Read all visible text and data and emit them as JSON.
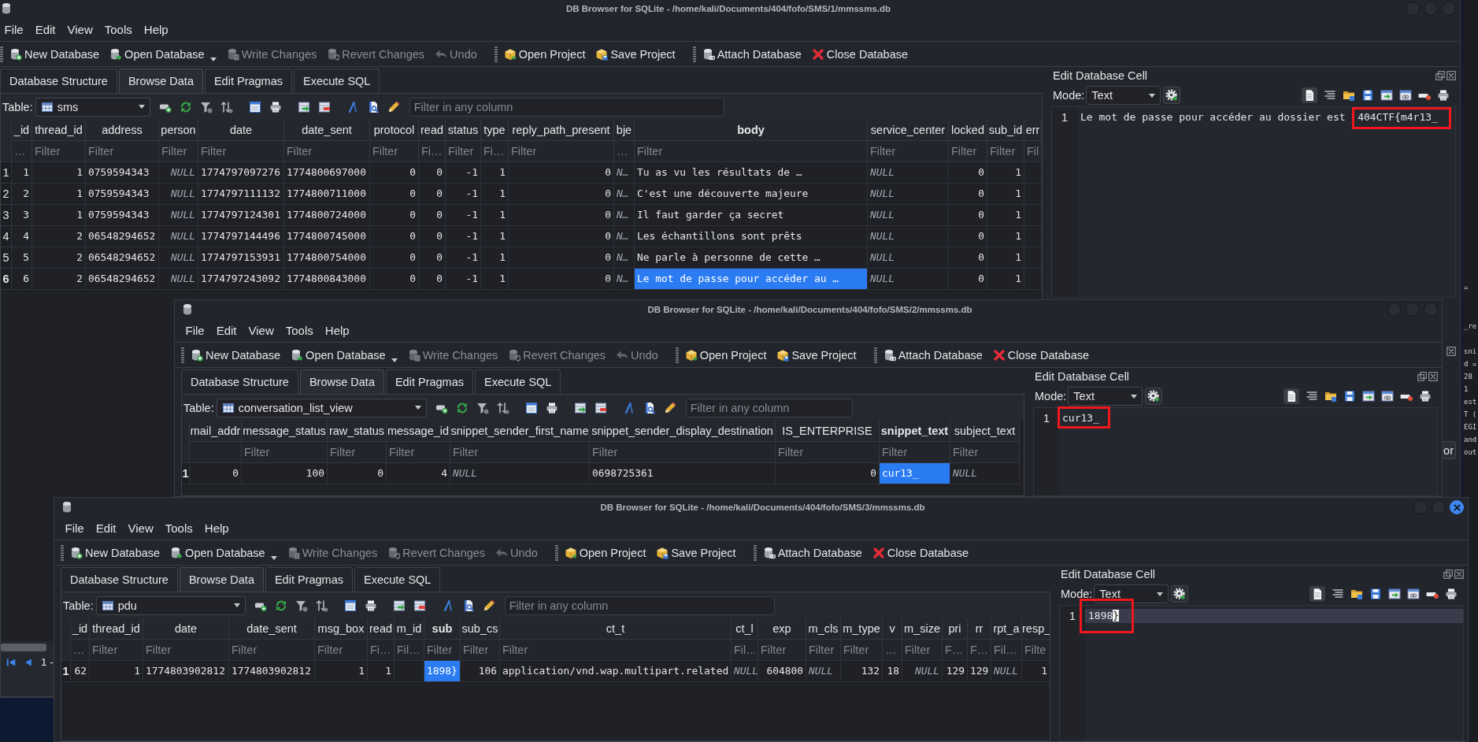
{
  "windows": [
    {
      "title": "DB Browser for SQLite - /home/kali/Documents/404/fofo/SMS/1/mmssms.db",
      "active": false,
      "menu": [
        "File",
        "Edit",
        "View",
        "Tools",
        "Help"
      ],
      "toolbar": [
        {
          "items": [
            {
              "label": "New Database",
              "disabled": false,
              "has_menu": false
            },
            {
              "label": "Open Database",
              "disabled": false,
              "has_menu": true
            },
            {
              "label": "Write Changes",
              "disabled": true,
              "has_menu": false
            },
            {
              "label": "Revert Changes",
              "disabled": true,
              "has_menu": false
            },
            {
              "label": "Undo",
              "disabled": true,
              "has_menu": false
            }
          ]
        },
        {
          "items": [
            {
              "label": "Open Project",
              "disabled": false,
              "has_menu": false
            },
            {
              "label": "Save Project",
              "disabled": false,
              "has_menu": false
            }
          ]
        },
        {
          "items": [
            {
              "label": "Attach Database",
              "disabled": false,
              "has_menu": false
            },
            {
              "label": "Close Database",
              "disabled": false,
              "has_menu": false
            }
          ]
        }
      ],
      "tabs": [
        {
          "label": "Database Structure",
          "selected": false
        },
        {
          "label": "Browse Data",
          "selected": true
        },
        {
          "label": "Edit Pragmas",
          "selected": false
        },
        {
          "label": "Execute SQL",
          "selected": false
        }
      ],
      "table_bar": {
        "label": "Table:",
        "table": "sms",
        "filter_placeholder": "Filter in any column"
      },
      "columns": [
        {
          "name": "_id",
          "placeholder": "…",
          "kind": "number",
          "shows_null": false,
          "selected": false
        },
        {
          "name": "thread_id",
          "placeholder": "Filter",
          "kind": "number",
          "shows_null": false,
          "selected": false
        },
        {
          "name": "address",
          "placeholder": "Filter",
          "kind": "text",
          "shows_null": false,
          "selected": false
        },
        {
          "name": "person",
          "placeholder": "Filter",
          "kind": "number",
          "shows_null": true,
          "selected": false
        },
        {
          "name": "date",
          "placeholder": "Filter",
          "kind": "text",
          "shows_null": false,
          "selected": false
        },
        {
          "name": "date_sent",
          "placeholder": "Filter",
          "kind": "text",
          "shows_null": false,
          "selected": false
        },
        {
          "name": "protocol",
          "placeholder": "Filter",
          "kind": "number",
          "shows_null": false,
          "selected": false
        },
        {
          "name": "read",
          "placeholder": "Fi…",
          "kind": "number",
          "shows_null": false,
          "selected": false
        },
        {
          "name": "status",
          "placeholder": "Filter",
          "kind": "number",
          "shows_null": false,
          "selected": false
        },
        {
          "name": "type",
          "placeholder": "Fi…",
          "kind": "number",
          "shows_null": false,
          "selected": false
        },
        {
          "name": "reply_path_present",
          "placeholder": "Filter",
          "kind": "number",
          "shows_null": false,
          "selected": false
        },
        {
          "name": "bje",
          "placeholder": "…",
          "kind": "text",
          "shows_null": true,
          "selected": false
        },
        {
          "name": "body",
          "placeholder": "Filter",
          "kind": "text",
          "shows_null": false,
          "selected": true
        },
        {
          "name": "service_center",
          "placeholder": "Filter",
          "kind": "text",
          "shows_null": true,
          "selected": false
        },
        {
          "name": "locked",
          "placeholder": "Filter",
          "kind": "number",
          "shows_null": false,
          "selected": false
        },
        {
          "name": "sub_id",
          "placeholder": "Filter",
          "kind": "number",
          "shows_null": false,
          "selected": false
        },
        {
          "name": "err",
          "placeholder": "Fil",
          "selected": false
        }
      ],
      "rows": [
        {
          "number": "1",
          "selected": false,
          "cells": [
            "1",
            "1",
            "0759594343",
            "NULL",
            "1774797097276",
            "1774800697000",
            "0",
            "0",
            "-1",
            "1",
            "0",
            "N…",
            "Tu as vu les résultats de …",
            "NULL",
            "0",
            "1"
          ]
        },
        {
          "number": "2",
          "selected": false,
          "cells": [
            "2",
            "1",
            "0759594343",
            "NULL",
            "1774797111132",
            "1774800711000",
            "0",
            "0",
            "-1",
            "1",
            "0",
            "N…",
            "C'est une découverte majeure",
            "NULL",
            "0",
            "1"
          ]
        },
        {
          "number": "3",
          "selected": false,
          "cells": [
            "3",
            "1",
            "0759594343",
            "NULL",
            "1774797124301",
            "1774800724000",
            "0",
            "0",
            "-1",
            "1",
            "0",
            "N…",
            "Il faut garder ça secret",
            "NULL",
            "0",
            "1"
          ]
        },
        {
          "number": "4",
          "selected": false,
          "cells": [
            "4",
            "2",
            "06548294652",
            "NULL",
            "1774797144496",
            "1774800745000",
            "0",
            "0",
            "-1",
            "1",
            "0",
            "N…",
            "Les échantillons sont prêts",
            "NULL",
            "0",
            "1"
          ]
        },
        {
          "number": "5",
          "selected": false,
          "cells": [
            "5",
            "2",
            "06548294652",
            "NULL",
            "1774797153931",
            "1774800754000",
            "0",
            "0",
            "-1",
            "1",
            "0",
            "N…",
            "Ne parle à personne de cette …",
            "NULL",
            "0",
            "1"
          ]
        },
        {
          "number": "6",
          "selected": true,
          "cells": [
            "6",
            "2",
            "06548294652",
            "NULL",
            "1774797243092",
            "1774800843000",
            "0",
            "0",
            "-1",
            "1",
            "0",
            "N…",
            "Le mot de passe pour accéder au …",
            "NULL",
            "0",
            "1"
          ]
        }
      ],
      "edit_cell": {
        "title": "Edit Database Cell",
        "mode_label": "Mode:",
        "mode": "Text",
        "line_number": "1",
        "text": "Le mot de passe pour accéder au dossier est",
        "boxed": {
          "text": "404CTF{m4r13_"
        },
        "line_highlight": false
      },
      "navigator": {
        "label": "1 -"
      },
      "side_dock": {
        "button": "or"
      }
    },
    {
      "title": "DB Browser for SQLite - /home/kali/Documents/404/fofo/SMS/2/mmssms.db",
      "active": false,
      "menu": [
        "File",
        "Edit",
        "View",
        "Tools",
        "Help"
      ],
      "toolbar": [
        {
          "items": [
            {
              "label": "New Database",
              "disabled": false,
              "has_menu": false
            },
            {
              "label": "Open Database",
              "disabled": false,
              "has_menu": true
            },
            {
              "label": "Write Changes",
              "disabled": true,
              "has_menu": false
            },
            {
              "label": "Revert Changes",
              "disabled": true,
              "has_menu": false
            },
            {
              "label": "Undo",
              "disabled": true,
              "has_menu": false
            }
          ]
        },
        {
          "items": [
            {
              "label": "Open Project",
              "disabled": false,
              "has_menu": false
            },
            {
              "label": "Save Project",
              "disabled": false,
              "has_menu": false
            }
          ]
        },
        {
          "items": [
            {
              "label": "Attach Database",
              "disabled": false,
              "has_menu": false
            },
            {
              "label": "Close Database",
              "disabled": false,
              "has_menu": false
            }
          ]
        }
      ],
      "tabs": [
        {
          "label": "Database Structure",
          "selected": false
        },
        {
          "label": "Browse Data",
          "selected": true
        },
        {
          "label": "Edit Pragmas",
          "selected": false
        },
        {
          "label": "Execute SQL",
          "selected": false
        }
      ],
      "table_bar": {
        "label": "Table:",
        "table": "conversation_list_view",
        "filter_placeholder": "Filter in any column"
      },
      "columns": [
        {
          "name": "mail_addr",
          "kind": "number",
          "shows_null": false,
          "selected": false
        },
        {
          "name": "message_status",
          "placeholder": "Filter",
          "kind": "number",
          "shows_null": false,
          "selected": false
        },
        {
          "name": "raw_status",
          "placeholder": "Filter",
          "kind": "number",
          "shows_null": false,
          "selected": false
        },
        {
          "name": "message_id",
          "placeholder": "Filter",
          "kind": "number",
          "shows_null": false,
          "selected": false
        },
        {
          "name": "snippet_sender_first_name",
          "placeholder": "Filter",
          "kind": "text",
          "shows_null": true,
          "selected": false
        },
        {
          "name": "snippet_sender_display_destination",
          "placeholder": "Filter",
          "kind": "text",
          "shows_null": false,
          "selected": false
        },
        {
          "name": "IS_ENTERPRISE",
          "placeholder": "Filter",
          "kind": "number",
          "shows_null": false,
          "selected": false
        },
        {
          "name": "snippet_text",
          "placeholder": "Filter",
          "kind": "text",
          "shows_null": false,
          "selected": true
        },
        {
          "name": "subject_text",
          "placeholder": "Filter",
          "kind": "text",
          "shows_null": true,
          "selected": false
        }
      ],
      "rows": [
        {
          "number": "1",
          "selected": true,
          "cells": [
            "0",
            "100",
            "0",
            "4",
            "NULL",
            "0698725361",
            "0",
            "cur13_",
            "NULL"
          ]
        }
      ],
      "edit_cell": {
        "title": "Edit Database Cell",
        "mode_label": "Mode:",
        "mode": "Text",
        "line_number": "1",
        "boxed": {
          "text": "cur13_"
        },
        "line_highlight": false
      }
    },
    {
      "title": "DB Browser for SQLite - /home/kali/Documents/404/fofo/SMS/3/mmssms.db",
      "active": true,
      "menu": [
        "File",
        "Edit",
        "View",
        "Tools",
        "Help"
      ],
      "toolbar": [
        {
          "items": [
            {
              "label": "New Database",
              "disabled": false,
              "has_menu": false
            },
            {
              "label": "Open Database",
              "disabled": false,
              "has_menu": true
            },
            {
              "label": "Write Changes",
              "disabled": true,
              "has_menu": false
            },
            {
              "label": "Revert Changes",
              "disabled": true,
              "has_menu": false
            },
            {
              "label": "Undo",
              "disabled": true,
              "has_menu": false
            }
          ]
        },
        {
          "items": [
            {
              "label": "Open Project",
              "disabled": false,
              "has_menu": false
            },
            {
              "label": "Save Project",
              "disabled": false,
              "has_menu": false
            }
          ]
        },
        {
          "items": [
            {
              "label": "Attach Database",
              "disabled": false,
              "has_menu": false
            },
            {
              "label": "Close Database",
              "disabled": false,
              "has_menu": false
            }
          ]
        }
      ],
      "tabs": [
        {
          "label": "Database Structure",
          "selected": false
        },
        {
          "label": "Browse Data",
          "selected": true
        },
        {
          "label": "Edit Pragmas",
          "selected": false
        },
        {
          "label": "Execute SQL",
          "selected": false
        }
      ],
      "table_bar": {
        "label": "Table:",
        "table": "pdu",
        "filter_placeholder": "Filter in any column"
      },
      "columns": [
        {
          "name": "_id",
          "placeholder": "…",
          "kind": "number",
          "shows_null": false,
          "selected": false
        },
        {
          "name": "thread_id",
          "placeholder": "Filter",
          "kind": "number",
          "shows_null": false,
          "selected": false
        },
        {
          "name": "date",
          "placeholder": "Filter",
          "kind": "text",
          "shows_null": false,
          "selected": false
        },
        {
          "name": "date_sent",
          "placeholder": "Filter",
          "kind": "text",
          "shows_null": false,
          "selected": false
        },
        {
          "name": "msg_box",
          "placeholder": "Filter",
          "kind": "number",
          "shows_null": false,
          "selected": false
        },
        {
          "name": "read",
          "placeholder": "Fi…",
          "kind": "number",
          "shows_null": false,
          "selected": false
        },
        {
          "name": "m_id",
          "placeholder": "Fil…",
          "selected": false
        },
        {
          "name": "sub",
          "placeholder": "Filter",
          "kind": "text",
          "shows_null": false,
          "selected": true
        },
        {
          "name": "sub_cs",
          "placeholder": "Filter",
          "kind": "number",
          "shows_null": false,
          "selected": false
        },
        {
          "name": "ct_t",
          "placeholder": "Filter",
          "kind": "text",
          "shows_null": false,
          "selected": false
        },
        {
          "name": "ct_l",
          "placeholder": "Fil…",
          "kind": "text",
          "shows_null": true,
          "selected": false
        },
        {
          "name": "exp",
          "placeholder": "Filter",
          "kind": "number",
          "shows_null": false,
          "selected": false
        },
        {
          "name": "m_cls",
          "placeholder": "Filter",
          "kind": "text",
          "shows_null": true,
          "selected": false
        },
        {
          "name": "m_type",
          "placeholder": "Filter",
          "kind": "number",
          "shows_null": false,
          "selected": false
        },
        {
          "name": "v",
          "placeholder": "…",
          "kind": "number",
          "shows_null": false,
          "selected": false
        },
        {
          "name": "m_size",
          "placeholder": "Filter",
          "kind": "number",
          "shows_null": true,
          "selected": false
        },
        {
          "name": "pri",
          "placeholder": "F…",
          "kind": "number",
          "shows_null": false,
          "selected": false
        },
        {
          "name": "rr",
          "placeholder": "F…",
          "kind": "number",
          "shows_null": false,
          "selected": false
        },
        {
          "name": "rpt_a",
          "placeholder": "Fil…",
          "kind": "text",
          "shows_null": true,
          "selected": false
        },
        {
          "name": "resp_",
          "placeholder": "Filte",
          "kind": "number",
          "shows_null": false,
          "selected": false
        }
      ],
      "rows": [
        {
          "number": "1",
          "selected": true,
          "cells": [
            "62",
            "1",
            "1774803902812",
            "1774803902812",
            "1",
            "1",
            null,
            "1898}",
            "106",
            "application/vnd.wap.multipart.related",
            "NULL",
            "604800",
            "NULL",
            "132",
            "18",
            "NULL",
            "129",
            "129",
            "NULL",
            "1"
          ]
        }
      ],
      "edit_cell": {
        "title": "Edit Database Cell",
        "mode_label": "Mode:",
        "mode": "Text",
        "line_number": "1",
        "boxed": {
          "text": "1898",
          "selection": "}"
        },
        "line_highlight": true
      }
    }
  ],
  "background_window": {
    "lines": [
      "=",
      "_re",
      "sni",
      "d =",
      "28",
      "1",
      "est",
      "T (",
      "EGI",
      "and",
      "out"
    ]
  }
}
